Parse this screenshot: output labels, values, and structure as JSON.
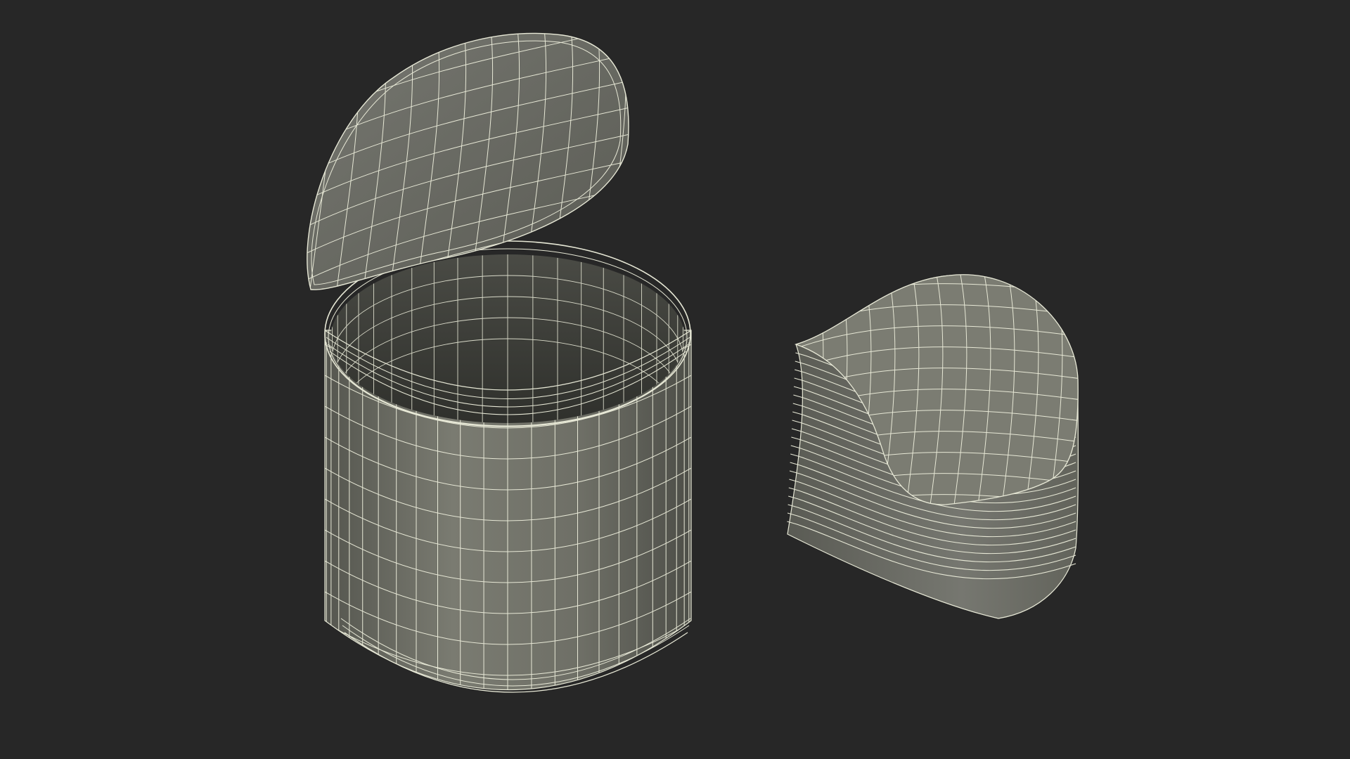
{
  "scene": {
    "background_color": "#272727",
    "surface_color": "#6f7066",
    "surface_dark_color": "#4a4b45",
    "interior_color": "#3b3c37",
    "wire_color": "#e7e8d6",
    "objects": [
      {
        "name": "open-tin-can",
        "parts": [
          "can-body",
          "can-interior",
          "can-rim",
          "can-lid"
        ]
      },
      {
        "name": "crushed-tin-can",
        "parts": [
          "crushed-body",
          "crushed-ribs",
          "crushed-top"
        ]
      }
    ]
  }
}
